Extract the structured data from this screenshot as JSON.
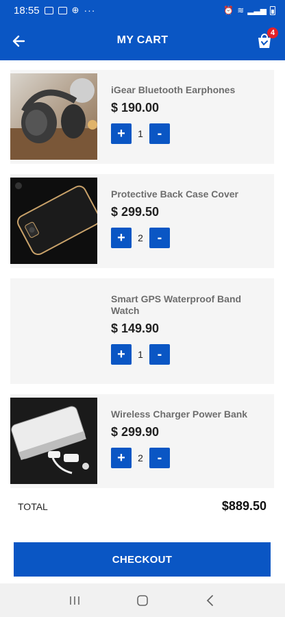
{
  "status_bar": {
    "time": "18:55",
    "more": "···"
  },
  "header": {
    "title": "MY CART",
    "cart_count": "4"
  },
  "items": [
    {
      "name": "iGear Bluetooth Earphones",
      "price": "$ 190.00",
      "qty": "1",
      "image": "earphones"
    },
    {
      "name": "Protective Back Case Cover",
      "price": "$ 299.50",
      "qty": "2",
      "image": "phone-case"
    },
    {
      "name": "Smart GPS Waterproof Band Watch",
      "price": "$ 149.90",
      "qty": "1",
      "image": ""
    },
    {
      "name": "Wireless Charger Power Bank",
      "price": "$ 299.90",
      "qty": "2",
      "image": "power-bank"
    }
  ],
  "controls": {
    "plus": "+",
    "minus": "-"
  },
  "total": {
    "label": "TOTAL",
    "value": "$889.50"
  },
  "checkout_label": "CHECKOUT",
  "colors": {
    "primary": "#0a56c4",
    "badge": "#e32129",
    "card_bg": "#f5f5f5"
  },
  "icons": {
    "back": "arrow-left-icon",
    "cart": "shopping-bag-icon",
    "nav_recents": "recents-icon",
    "nav_home": "home-icon",
    "nav_back": "chevron-left-icon"
  }
}
